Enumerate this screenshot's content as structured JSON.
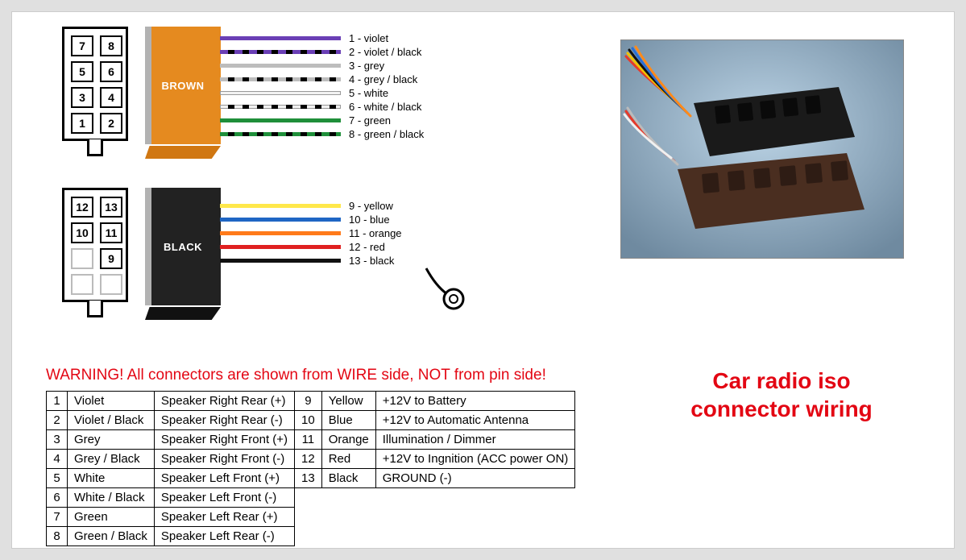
{
  "title": "Car radio iso connector wiring",
  "warning": "WARNING! All connectors are shown from WIRE side, NOT from pin side!",
  "housings": {
    "a": "BROWN",
    "b": "BLACK"
  },
  "connector_a_pins": [
    {
      "n": "7",
      "col": 0,
      "row": 0
    },
    {
      "n": "8",
      "col": 1,
      "row": 0
    },
    {
      "n": "5",
      "col": 0,
      "row": 1
    },
    {
      "n": "6",
      "col": 1,
      "row": 1
    },
    {
      "n": "3",
      "col": 0,
      "row": 2
    },
    {
      "n": "4",
      "col": 1,
      "row": 2
    },
    {
      "n": "1",
      "col": 0,
      "row": 3
    },
    {
      "n": "2",
      "col": 1,
      "row": 3
    }
  ],
  "connector_b_pins": [
    {
      "n": "12",
      "col": 0,
      "row": 0
    },
    {
      "n": "13",
      "col": 1,
      "row": 0
    },
    {
      "n": "10",
      "col": 0,
      "row": 1
    },
    {
      "n": "11",
      "col": 1,
      "row": 1
    },
    {
      "n": "",
      "col": 0,
      "row": 2,
      "blank": true
    },
    {
      "n": "9",
      "col": 1,
      "row": 2
    },
    {
      "n": "",
      "col": 0,
      "row": 3,
      "blank": true
    },
    {
      "n": "",
      "col": 1,
      "row": 3,
      "blank": true
    }
  ],
  "wires_a": [
    {
      "label": "1 - violet",
      "color": "#6a3fb5",
      "striped": false
    },
    {
      "label": "2 - violet / black",
      "color": "#6a3fb5",
      "striped": true
    },
    {
      "label": "3 - grey",
      "color": "#bdbdbd",
      "striped": false
    },
    {
      "label": "4 - grey / black",
      "color": "#bdbdbd",
      "striped": true
    },
    {
      "label": "5 - white",
      "color": "#f2f2f2",
      "striped": false,
      "outline": true
    },
    {
      "label": "6 - white / black",
      "color": "#f2f2f2",
      "striped": true,
      "outline": true
    },
    {
      "label": "7 - green",
      "color": "#1f8f3a",
      "striped": false
    },
    {
      "label": "8 - green / black",
      "color": "#1f8f3a",
      "striped": true
    }
  ],
  "wires_b": [
    {
      "label": "9 - yellow",
      "color": "#ffe84a",
      "striped": false
    },
    {
      "label": "10 - blue",
      "color": "#1f66c4",
      "striped": false
    },
    {
      "label": "11 - orange",
      "color": "#ff7a1a",
      "striped": false
    },
    {
      "label": "12 - red",
      "color": "#e02020",
      "striped": false
    },
    {
      "label": "13 - black",
      "color": "#111111",
      "striped": false
    }
  ],
  "table_left": [
    {
      "num": "1",
      "color": "Violet",
      "func": "Speaker Right Rear (+)"
    },
    {
      "num": "2",
      "color": "Violet / Black",
      "func": "Speaker Right Rear (-)"
    },
    {
      "num": "3",
      "color": "Grey",
      "func": "Speaker Right Front (+)"
    },
    {
      "num": "4",
      "color": "Grey / Black",
      "func": "Speaker Right Front (-)"
    },
    {
      "num": "5",
      "color": "White",
      "func": "Speaker Left Front (+)"
    },
    {
      "num": "6",
      "color": "White / Black",
      "func": "Speaker Left Front (-)"
    },
    {
      "num": "7",
      "color": "Green",
      "func": "Speaker Left Rear (+)"
    },
    {
      "num": "8",
      "color": "Green / Black",
      "func": "Speaker Left Rear (-)"
    }
  ],
  "table_right": [
    {
      "num": "9",
      "color": "Yellow",
      "func": "+12V to Battery"
    },
    {
      "num": "10",
      "color": "Blue",
      "func": "+12V to Automatic Antenna"
    },
    {
      "num": "11",
      "color": "Orange",
      "func": "Illumination / Dimmer"
    },
    {
      "num": "12",
      "color": "Red",
      "func": "+12V to Ingnition (ACC power ON)"
    },
    {
      "num": "13",
      "color": "Black",
      "func": "GROUND (-)"
    }
  ]
}
